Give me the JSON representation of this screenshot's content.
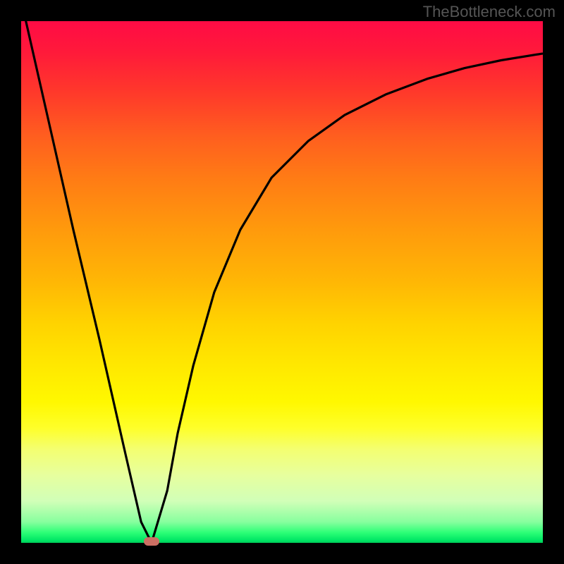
{
  "watermark": "TheBottleneck.com",
  "chart_data": {
    "type": "line",
    "title": "",
    "xlabel": "",
    "ylabel": "",
    "xlim": [
      0,
      100
    ],
    "ylim": [
      0,
      100
    ],
    "series": [
      {
        "name": "curve",
        "x": [
          0,
          5,
          10,
          15,
          20,
          23,
          25,
          28,
          30,
          33,
          37,
          42,
          48,
          55,
          62,
          70,
          78,
          85,
          92,
          100
        ],
        "values": [
          104,
          82,
          60,
          39,
          17,
          4,
          0,
          10,
          21,
          34,
          48,
          60,
          70,
          77,
          82,
          86,
          89,
          91,
          92.5,
          93.8
        ]
      }
    ],
    "marker": {
      "x": 25,
      "y": 0,
      "color": "#cc6f63"
    },
    "background_gradient": {
      "top": "#ff0b45",
      "mid": "#ffd300",
      "bottom": "#00cc58"
    }
  }
}
